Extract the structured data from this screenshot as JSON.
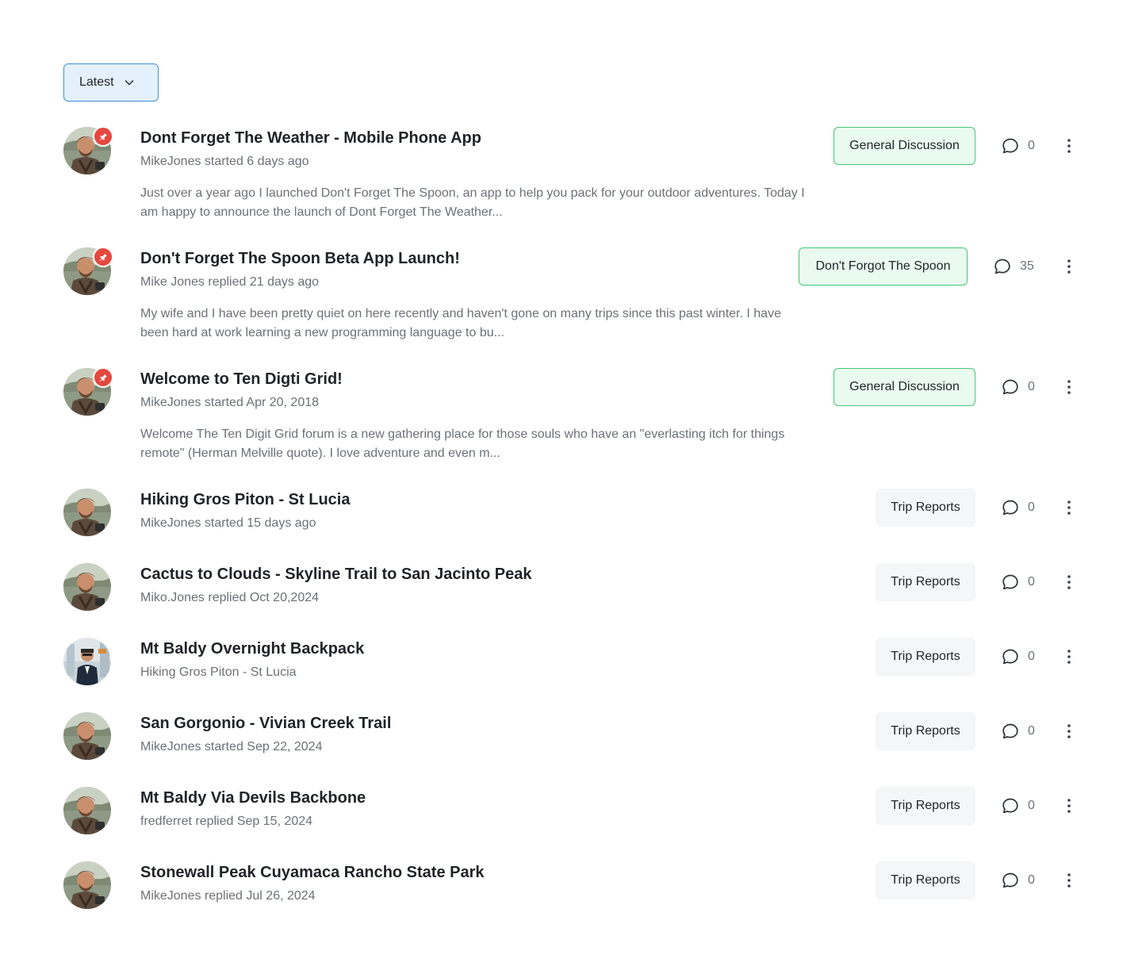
{
  "sort": {
    "label": "Latest"
  },
  "colors": {
    "accent_blue": "#3f8fd8",
    "tag_green_border": "#45c777",
    "tag_green_bg": "#e9faef",
    "pin_red": "#e5483f"
  },
  "topics": [
    {
      "title": "Dont Forget The Weather - Mobile Phone App",
      "meta": "MikeJones started 6 days ago",
      "excerpt": "Just over a year ago I launched Don't Forget The Spoon, an app to help you pack for your outdoor adventures. Today I am happy to announce the launch of Dont Forget The Weather...",
      "tag": "General Discussion",
      "tag_style": "green",
      "comments": "0",
      "pinned": true,
      "avatar_icon": "user-avatar-hiker"
    },
    {
      "title": "Don't Forget The Spoon Beta App Launch!",
      "meta": "Mike Jones replied 21 days ago",
      "excerpt": "My wife and I have been pretty quiet on here recently and haven't gone on many trips since this past winter. I have been hard at work learning a new programming language to bu...",
      "tag": "Don't Forgot The Spoon",
      "tag_style": "green",
      "comments": "35",
      "pinned": true,
      "avatar_icon": "user-avatar-hiker"
    },
    {
      "title": "Welcome to Ten Digti Grid!",
      "meta": "MikeJones started Apr 20, 2018",
      "excerpt": "Welcome The Ten Digit Grid forum is a new gathering place for those souls who have an \"everlasting itch for things remote\" (Herman Melville quote). I love adventure and even m...",
      "tag": "General Discussion",
      "tag_style": "green",
      "comments": "0",
      "pinned": true,
      "avatar_icon": "user-avatar-hiker"
    },
    {
      "title": "Hiking Gros Piton - St Lucia",
      "meta": "MikeJones started 15 days ago",
      "tag": "Trip Reports",
      "tag_style": "gray",
      "comments": "0",
      "pinned": false,
      "avatar_icon": "user-avatar-hiker"
    },
    {
      "title": "Cactus to Clouds - Skyline Trail to San Jacinto Peak",
      "meta": "Miko.Jones replied Oct 20,2024",
      "tag": "Trip Reports",
      "tag_style": "gray",
      "comments": "0",
      "pinned": false,
      "avatar_icon": "user-avatar-hiker"
    },
    {
      "title": "Mt Baldy Overnight Backpack",
      "meta": "Hiking Gros Piton - St Lucia",
      "tag": "Trip Reports",
      "tag_style": "gray",
      "comments": "0",
      "pinned": false,
      "avatar_icon": "user-avatar-suit"
    },
    {
      "title": "San Gorgonio - Vivian Creek Trail",
      "meta": "MikeJones started Sep 22, 2024",
      "tag": "Trip Reports",
      "tag_style": "gray",
      "comments": "0",
      "pinned": false,
      "avatar_icon": "user-avatar-hiker"
    },
    {
      "title": "Mt Baldy Via Devils Backbone",
      "meta": "fredferret replied Sep 15, 2024",
      "tag": "Trip Reports",
      "tag_style": "gray",
      "comments": "0",
      "pinned": false,
      "avatar_icon": "user-avatar-hiker"
    },
    {
      "title": "Stonewall Peak Cuyamaca Rancho State Park",
      "meta": "MikeJones replied Jul 26, 2024",
      "tag": "Trip Reports",
      "tag_style": "gray",
      "comments": "0",
      "pinned": false,
      "avatar_icon": "user-avatar-hiker"
    }
  ]
}
